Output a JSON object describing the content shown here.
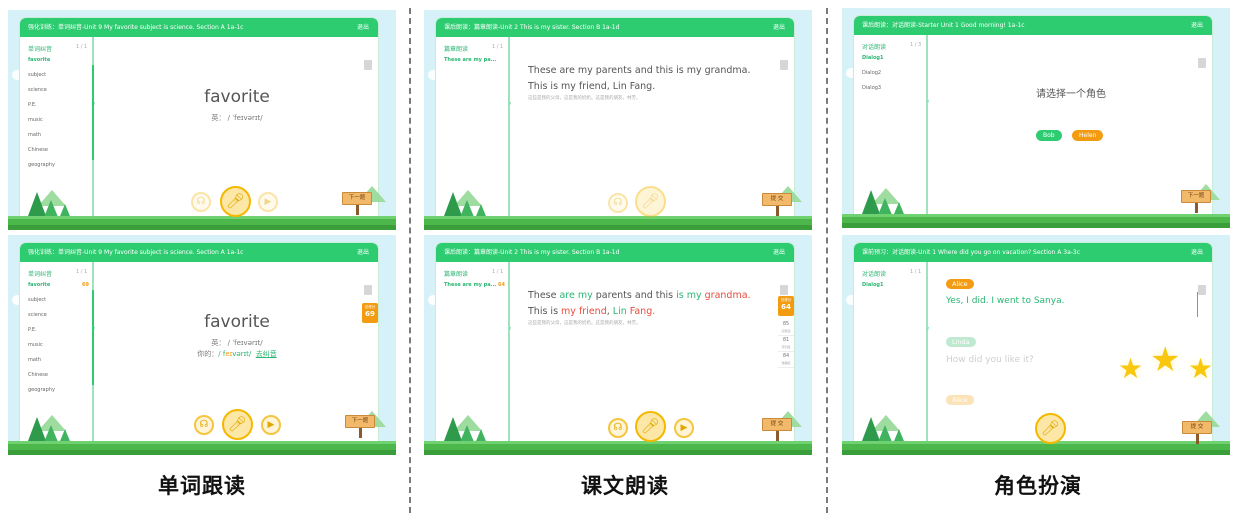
{
  "captions": [
    "单词跟读",
    "课文朗读",
    "角色扮演"
  ],
  "common": {
    "exit_label": "退出",
    "next_label": "下一题",
    "submit_label": "提 交"
  },
  "screens": {
    "word_a": {
      "title": "强化训练：单词纠音-Unit 9 My favorite subject is science. Section A 1a-1c",
      "sidebar_head": "单词纠音",
      "sidebar_count": "1 / 1",
      "items": [
        "favorite",
        "subject",
        "science",
        "P.E.",
        "music",
        "math",
        "Chinese",
        "geography"
      ],
      "word": "favorite",
      "phonetic": "英： / ˈfeɪvərɪt/"
    },
    "word_b": {
      "title": "强化训练：单词纠音-Unit 9 My favorite subject is science. Section A 1a-1c",
      "sidebar_head": "单词纠音",
      "sidebar_count": "1 / 1",
      "items": [
        "favorite",
        "subject",
        "science",
        "P.E.",
        "music",
        "math",
        "Chinese",
        "geography"
      ],
      "first_item_score": "69",
      "word": "favorite",
      "phonetic": "英： / ˈfeɪvərɪt/",
      "your_read_label": "你的：",
      "your_read_a": "/ f",
      "your_read_b": "eɪ",
      "your_read_c": "vərɪt/",
      "replay_label": "去纠音",
      "score_label": "总得分",
      "score": "69"
    },
    "text_a": {
      "title": "课后朗读：篇章朗读-Unit 2 This is my sister. Section B 1a-1d",
      "sidebar_head": "篇章朗读",
      "sidebar_count": "1 / 1",
      "item": "These are my pa...",
      "sentence": "These are my parents and this is my grandma. This is my friend, Lin Fang.",
      "translation": "这些是我的父母，这是我的奶奶。这是我的朋友，林芳。"
    },
    "text_b": {
      "title": "课后朗读：篇章朗读-Unit 2 This is my sister. Section B 1a-1d",
      "sidebar_head": "篇章朗读",
      "sidebar_count": "1 / 1",
      "item": "These are my pa...",
      "item_score": "64",
      "s": [
        "These ",
        "are my ",
        "parents and this ",
        "is my ",
        "grandma. ",
        "This is ",
        "my friend",
        ", ",
        "Lin ",
        "Fang."
      ],
      "translation": "这些是我的父母，这是我的奶奶。这是我的朋友，林芳。",
      "score_label": "总得分",
      "score": "64",
      "sub_scores": [
        {
          "v": "85",
          "l": "完整度"
        },
        {
          "v": "81",
          "l": "流利度"
        },
        {
          "v": "84",
          "l": "准确度"
        }
      ]
    },
    "role_a": {
      "title": "课后朗读：对话朗读-Starter Unit 1 Good morning! 1a-1c",
      "sidebar_head": "对话朗读",
      "sidebar_count": "1 / 3",
      "items": [
        "Dialog1",
        "Dialog2",
        "Dialog3"
      ],
      "prompt": "请选择一个角色",
      "roles": [
        "Bob",
        "Helen"
      ]
    },
    "role_b": {
      "title": "课前预习：对话朗读-Unit 1 Where did you go on vacation? Section A 3a-3c",
      "sidebar_head": "对话朗读",
      "sidebar_count": "1 / 1",
      "items": [
        "Dialog1"
      ],
      "speaker1": "Alice",
      "line1": "Yes, I did. I went to Sanya.",
      "speaker2": "Linda",
      "line2": "How did you like it?",
      "speaker3": "Alice"
    }
  },
  "colors": {
    "green": "#2ecc71",
    "orange": "#f39c12",
    "sky": "#d7f1f8"
  }
}
